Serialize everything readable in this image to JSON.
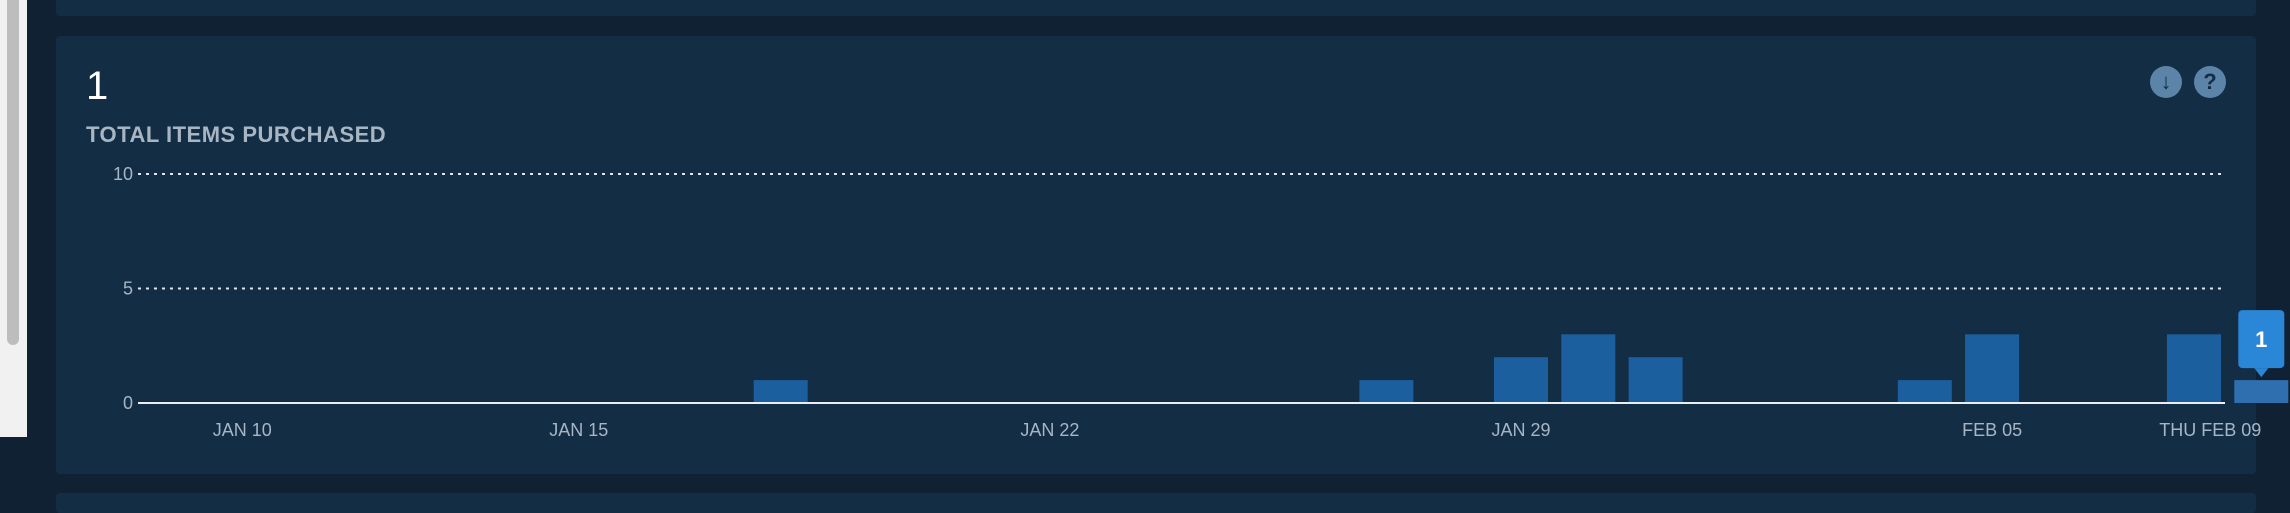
{
  "metric": {
    "value": "1",
    "title": "TOTAL ITEMS PURCHASED"
  },
  "toolbar": {
    "download_icon": "download-circle-icon",
    "help_icon": "question-circle-icon"
  },
  "colors": {
    "page_background": "#102133",
    "card_background": "#132d44",
    "bar": "#1c5f9e",
    "bar_highlight": "#2f6fb0",
    "tooltip": "#2a86d6",
    "axis_text": "#a8b6c4",
    "gridline": "#dde6ee"
  },
  "chart_data": {
    "type": "bar",
    "title": "TOTAL ITEMS PURCHASED",
    "xlabel": "",
    "ylabel": "",
    "ylim": [
      0,
      10
    ],
    "yticks": [
      0,
      5,
      10
    ],
    "grid": true,
    "x_start": "Jan 09",
    "x_end": "Feb 09",
    "bars": [
      {
        "date": "Jan 18",
        "value": 1
      },
      {
        "date": "Jan 27",
        "value": 1
      },
      {
        "date": "Jan 29",
        "value": 2
      },
      {
        "date": "Jan 30",
        "value": 3
      },
      {
        "date": "Jan 31",
        "value": 2
      },
      {
        "date": "Feb 04",
        "value": 1
      },
      {
        "date": "Feb 05",
        "value": 3
      },
      {
        "date": "Feb 08",
        "value": 3
      },
      {
        "date": "Feb 09",
        "value": 1
      }
    ],
    "xticks": [
      {
        "label": "JAN 10",
        "date": "Jan 10"
      },
      {
        "label": "JAN 15",
        "date": "Jan 15"
      },
      {
        "label": "JAN 22",
        "date": "Jan 22"
      },
      {
        "label": "JAN 29",
        "date": "Jan 29"
      },
      {
        "label": "FEB 05",
        "date": "Feb 05"
      },
      {
        "label": "THU FEB 09",
        "date": "Feb 09"
      }
    ],
    "tooltip": {
      "date": "Feb 09",
      "value": "1"
    }
  }
}
